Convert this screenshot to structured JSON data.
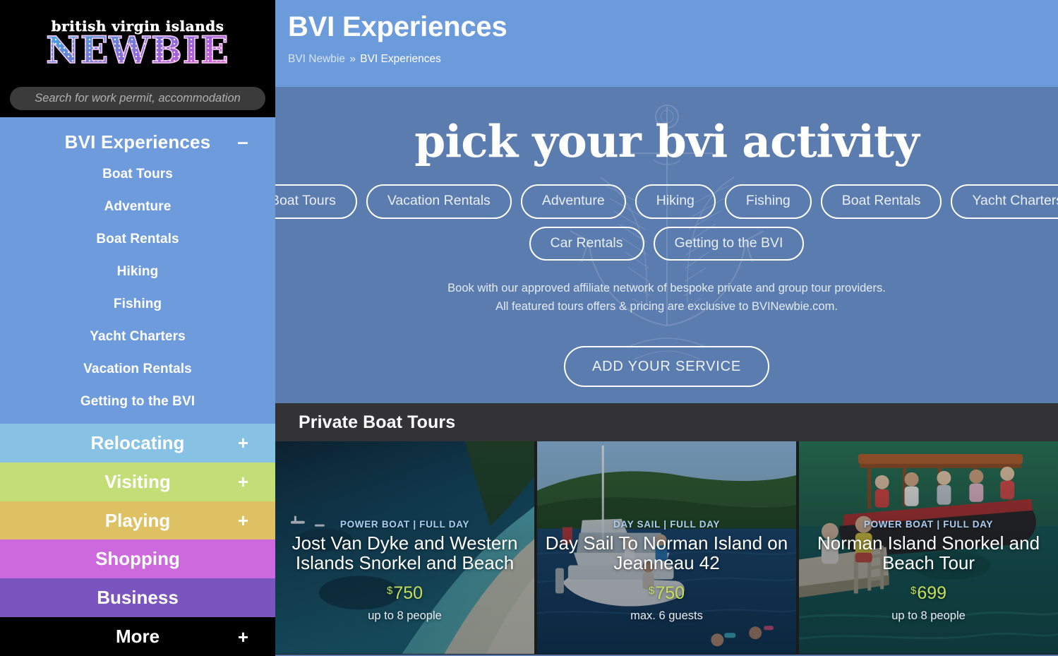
{
  "brand": {
    "logo_top": "british virgin islands",
    "logo_main": "NEWBIE"
  },
  "search": {
    "placeholder": "Search for work permit, accommodation",
    "value": ""
  },
  "sidebar": {
    "open_section": {
      "label": "BVI Experiences",
      "toggle": "–",
      "items": [
        {
          "label": "Boat Tours"
        },
        {
          "label": "Adventure"
        },
        {
          "label": "Boat Rentals"
        },
        {
          "label": "Hiking"
        },
        {
          "label": "Fishing"
        },
        {
          "label": "Yacht Charters"
        },
        {
          "label": "Vacation Rentals"
        },
        {
          "label": "Getting to the BVI"
        }
      ]
    },
    "sections": [
      {
        "label": "Relocating",
        "toggle": "+",
        "color": "#87c1e3"
      },
      {
        "label": "Visiting",
        "toggle": "+",
        "color": "#c3de77"
      },
      {
        "label": "Playing",
        "toggle": "+",
        "color": "#ddc163"
      },
      {
        "label": "Shopping",
        "toggle": "",
        "color": "#cc69dd"
      },
      {
        "label": "Business",
        "toggle": "",
        "color": "#7a55c0"
      },
      {
        "label": "More",
        "toggle": "+",
        "color": "#000000"
      }
    ]
  },
  "header": {
    "title": "BVI Experiences",
    "breadcrumb_home": "BVI Newbie",
    "breadcrumb_sep": "»",
    "breadcrumb_current": "BVI Experiences",
    "bg_color": "#6c9bdc"
  },
  "hero": {
    "title": "pick your bvi activity",
    "bg_color": "#5b7cae",
    "pills_row1": [
      {
        "label": "Boat Tours"
      },
      {
        "label": "Vacation Rentals"
      },
      {
        "label": "Adventure"
      },
      {
        "label": "Hiking"
      },
      {
        "label": "Fishing"
      },
      {
        "label": "Boat Rentals"
      },
      {
        "label": "Yacht Charters"
      }
    ],
    "pills_row2": [
      {
        "label": "Car Rentals"
      },
      {
        "label": "Getting to the BVI"
      }
    ],
    "description_line1": "Book with our approved affiliate network of bespoke private and group tour providers.",
    "description_line2": "All featured tours offers & pricing are exclusive to BVINewbie.com.",
    "cta_label": "ADD YOUR SERVICE"
  },
  "section": {
    "title": "Private Boat Tours",
    "bar_color": "#333335"
  },
  "cards": [
    {
      "kicker": "POWER BOAT | FULL DAY",
      "title": "Jost Van Dyke and Western Islands Snorkel and Beach",
      "currency": "$",
      "price": "750",
      "capacity": "up to 8 people",
      "price_color": "#c5de5c"
    },
    {
      "kicker": "DAY SAIL | FULL DAY",
      "title": "Day Sail To Norman Island on Jeanneau 42",
      "currency": "$",
      "price": "750",
      "capacity": "max. 6 guests",
      "price_color": "#c5de5c"
    },
    {
      "kicker": "POWER BOAT | FULL DAY",
      "title": "Norman Island Snorkel and Beach Tour",
      "currency": "$",
      "price": "699",
      "capacity": "up to 8 people",
      "price_color": "#c5de5c"
    }
  ]
}
